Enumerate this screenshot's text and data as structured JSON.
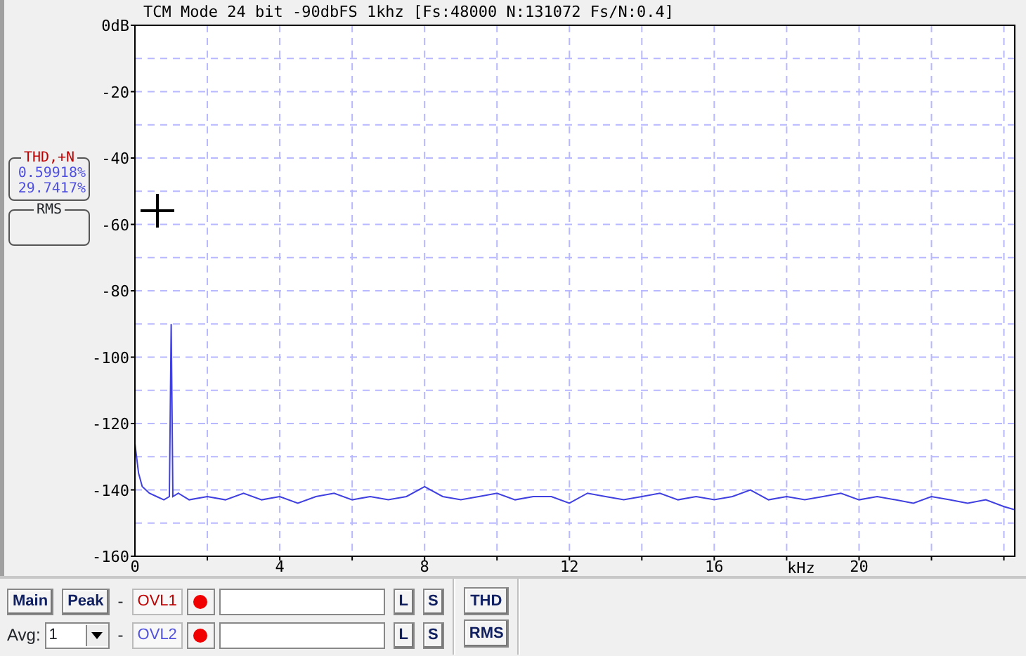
{
  "readouts": [
    {
      "title": "THD,+N",
      "values": [
        "0.59918%",
        "29.7417%"
      ]
    },
    {
      "title": "RMS"
    }
  ],
  "chart": {
    "chart_data": {
      "type": "line",
      "title": "TCM Mode 24 bit -90dbFS 1khz  [Fs:48000 N:131072 Fs/N:0.4]",
      "xlabel": "kHz",
      "xlim": [
        0,
        24.3
      ],
      "grid": true,
      "ylim": [
        -160,
        0
      ],
      "xticks": [
        0,
        4,
        8,
        12,
        16,
        20
      ],
      "yticks": [
        {
          "value": 0,
          "label": "0dB"
        },
        -20,
        -40,
        -60,
        -80,
        -100,
        -120,
        -140,
        -160
      ],
      "x": [
        0,
        0.1,
        0.2,
        0.4,
        0.6,
        0.8,
        0.95,
        1,
        1.05,
        1.2,
        1.5,
        2,
        2.5,
        3,
        3.5,
        4,
        4.5,
        5,
        5.5,
        6,
        6.5,
        7,
        7.5,
        8,
        8.5,
        9,
        9.5,
        10,
        10.5,
        11,
        11.5,
        12,
        12.5,
        13,
        13.5,
        14,
        14.5,
        15,
        15.5,
        16,
        16.5,
        17,
        17.5,
        18,
        18.5,
        19,
        19.5,
        20,
        20.5,
        21,
        21.5,
        22,
        22.5,
        23,
        23.5,
        24,
        24.3
      ],
      "series": [
        {
          "color": "#4040e0",
          "values": [
            -126,
            -135,
            -139,
            -141,
            -142,
            -143,
            -142,
            -90,
            -142,
            -141,
            -143,
            -142,
            -143,
            -141,
            -143,
            -142,
            -144,
            -142,
            -141,
            -143,
            -142,
            -143,
            -142,
            -139,
            -142,
            -143,
            -142,
            -141,
            -143,
            -142,
            -142,
            -144,
            -141,
            -142,
            -143,
            -142,
            -141,
            -143,
            -142,
            -143,
            -142,
            -140,
            -143,
            -142,
            -143,
            -142,
            -141,
            -143,
            -142,
            -143,
            -144,
            -142,
            -143,
            -144,
            -143,
            -145,
            -146
          ]
        }
      ]
    }
  },
  "toolbar": {
    "main_button": "Main",
    "peak_button": "Peak",
    "avg_label": "Avg:",
    "avg_value": "1",
    "channels": [
      {
        "dash": "-",
        "label": "OVL1",
        "color": "#c00000",
        "l_button": "L",
        "s_button": "S"
      },
      {
        "dash": "-",
        "label": "OVL2",
        "color": "#5050e0",
        "l_button": "L",
        "s_button": "S"
      }
    ],
    "mode_buttons": [
      "THD",
      "RMS"
    ]
  }
}
